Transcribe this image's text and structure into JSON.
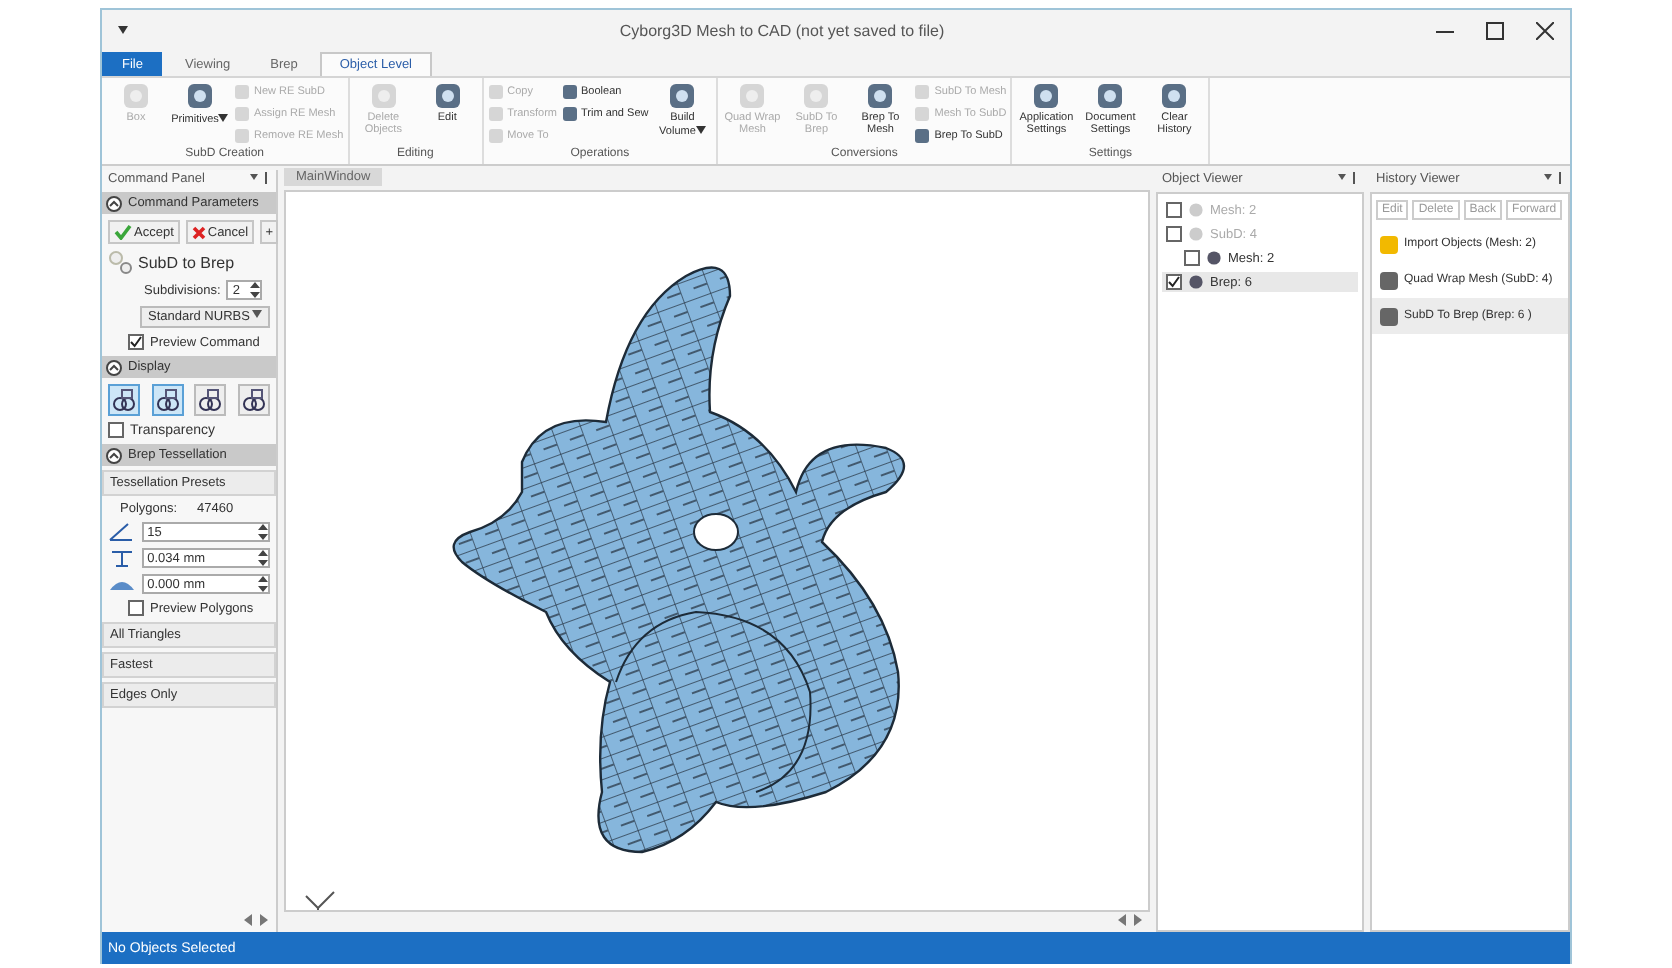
{
  "window": {
    "title": "Cyborg3D Mesh to CAD  (not yet saved to file)"
  },
  "tabs": [
    {
      "label": "File",
      "kind": "file",
      "selected": false
    },
    {
      "label": "Viewing",
      "kind": "tab",
      "selected": false
    },
    {
      "label": "Brep",
      "kind": "tab",
      "selected": false
    },
    {
      "label": "Object Level",
      "kind": "tab",
      "selected": true
    }
  ],
  "ribbon": [
    {
      "label": "SubD Creation",
      "items": [
        {
          "kind": "large",
          "label": "Box",
          "disabled": true
        },
        {
          "kind": "large",
          "label": "Primitives",
          "dropdown": true,
          "disabled": false
        },
        {
          "kind": "small",
          "label": "New RE SubD",
          "disabled": true
        },
        {
          "kind": "small",
          "label": "Assign RE Mesh",
          "disabled": true
        },
        {
          "kind": "small",
          "label": "Remove RE Mesh",
          "disabled": true
        }
      ]
    },
    {
      "label": "Editing",
      "items": [
        {
          "kind": "large",
          "label": "Delete Objects",
          "disabled": true
        },
        {
          "kind": "large",
          "label": "Edit",
          "disabled": false
        }
      ]
    },
    {
      "label": "Operations",
      "items": [
        {
          "kind": "small",
          "label": "Copy",
          "disabled": true
        },
        {
          "kind": "small",
          "label": "Transform",
          "disabled": true
        },
        {
          "kind": "small",
          "label": "Move To",
          "disabled": true
        },
        {
          "kind": "small",
          "label": "Boolean",
          "disabled": false
        },
        {
          "kind": "small",
          "label": "Trim and Sew",
          "disabled": false
        },
        {
          "kind": "large",
          "label": "Build Volume",
          "dropdown": true,
          "disabled": false
        }
      ]
    },
    {
      "label": "Conversions",
      "items": [
        {
          "kind": "large",
          "label": "Quad Wrap Mesh",
          "disabled": true
        },
        {
          "kind": "large",
          "label": "SubD To Brep",
          "disabled": true
        },
        {
          "kind": "large",
          "label": "Brep To Mesh",
          "disabled": false
        },
        {
          "kind": "small",
          "label": "SubD To Mesh",
          "disabled": true
        },
        {
          "kind": "small",
          "label": "Mesh To SubD",
          "disabled": true
        },
        {
          "kind": "small",
          "label": "Brep To SubD",
          "disabled": false
        }
      ]
    },
    {
      "label": "Settings",
      "items": [
        {
          "kind": "large",
          "label": "Application Settings",
          "disabled": false
        },
        {
          "kind": "large",
          "label": "Document Settings",
          "disabled": false
        },
        {
          "kind": "large",
          "label": "Clear History",
          "disabled": false
        }
      ]
    }
  ],
  "command_panel": {
    "title": "Command Panel",
    "parameters": {
      "title": "Command Parameters",
      "expanded": true,
      "accept": "Accept",
      "cancel": "Cancel",
      "add": "+",
      "command": "SubD to Brep",
      "subdivisions_label": "Subdivisions:",
      "subdivisions": "2",
      "method": "Standard NURBS",
      "preview": {
        "label": "Preview Command",
        "checked": true
      }
    },
    "display": {
      "title": "Display",
      "expanded": true,
      "modes": [
        {
          "selected": true
        },
        {
          "selected": true
        },
        {
          "selected": false
        },
        {
          "selected": false
        }
      ],
      "transparency": {
        "label": "Transparency",
        "checked": false
      }
    },
    "tessellation": {
      "title": "Brep Tessellation",
      "expanded": true,
      "presets_title": "Tessellation Presets",
      "polygons_label": "Polygons:",
      "polygons": "47460",
      "fields": [
        "15",
        "0.034 mm",
        "0.000 mm"
      ],
      "preview": {
        "label": "Preview Polygons",
        "checked": false
      },
      "presets": [
        "All Triangles",
        "Fastest",
        "Edges Only"
      ]
    }
  },
  "viewport": {
    "tab": "MainWindow"
  },
  "object_viewer": {
    "title": "Object Viewer",
    "items": [
      {
        "label": "Mesh: 2",
        "checked": false,
        "disabled": true,
        "selected": false
      },
      {
        "label": "SubD: 4",
        "checked": false,
        "disabled": true,
        "selected": false,
        "children": [
          {
            "label": "Mesh: 2",
            "checked": false,
            "disabled": false,
            "selected": false
          }
        ]
      },
      {
        "label": "Brep: 6",
        "checked": true,
        "disabled": false,
        "selected": true
      }
    ]
  },
  "history_viewer": {
    "title": "History Viewer",
    "buttons": [
      "Edit",
      "Delete",
      "Back",
      "Forward"
    ],
    "items": [
      {
        "label": "Import Objects (Mesh: 2)",
        "selected": false
      },
      {
        "label": "Quad Wrap Mesh (SubD: 4)",
        "selected": false
      },
      {
        "label": "SubD To Brep (Brep: 6 )",
        "selected": true
      }
    ]
  },
  "status_bar": "No Objects Selected"
}
